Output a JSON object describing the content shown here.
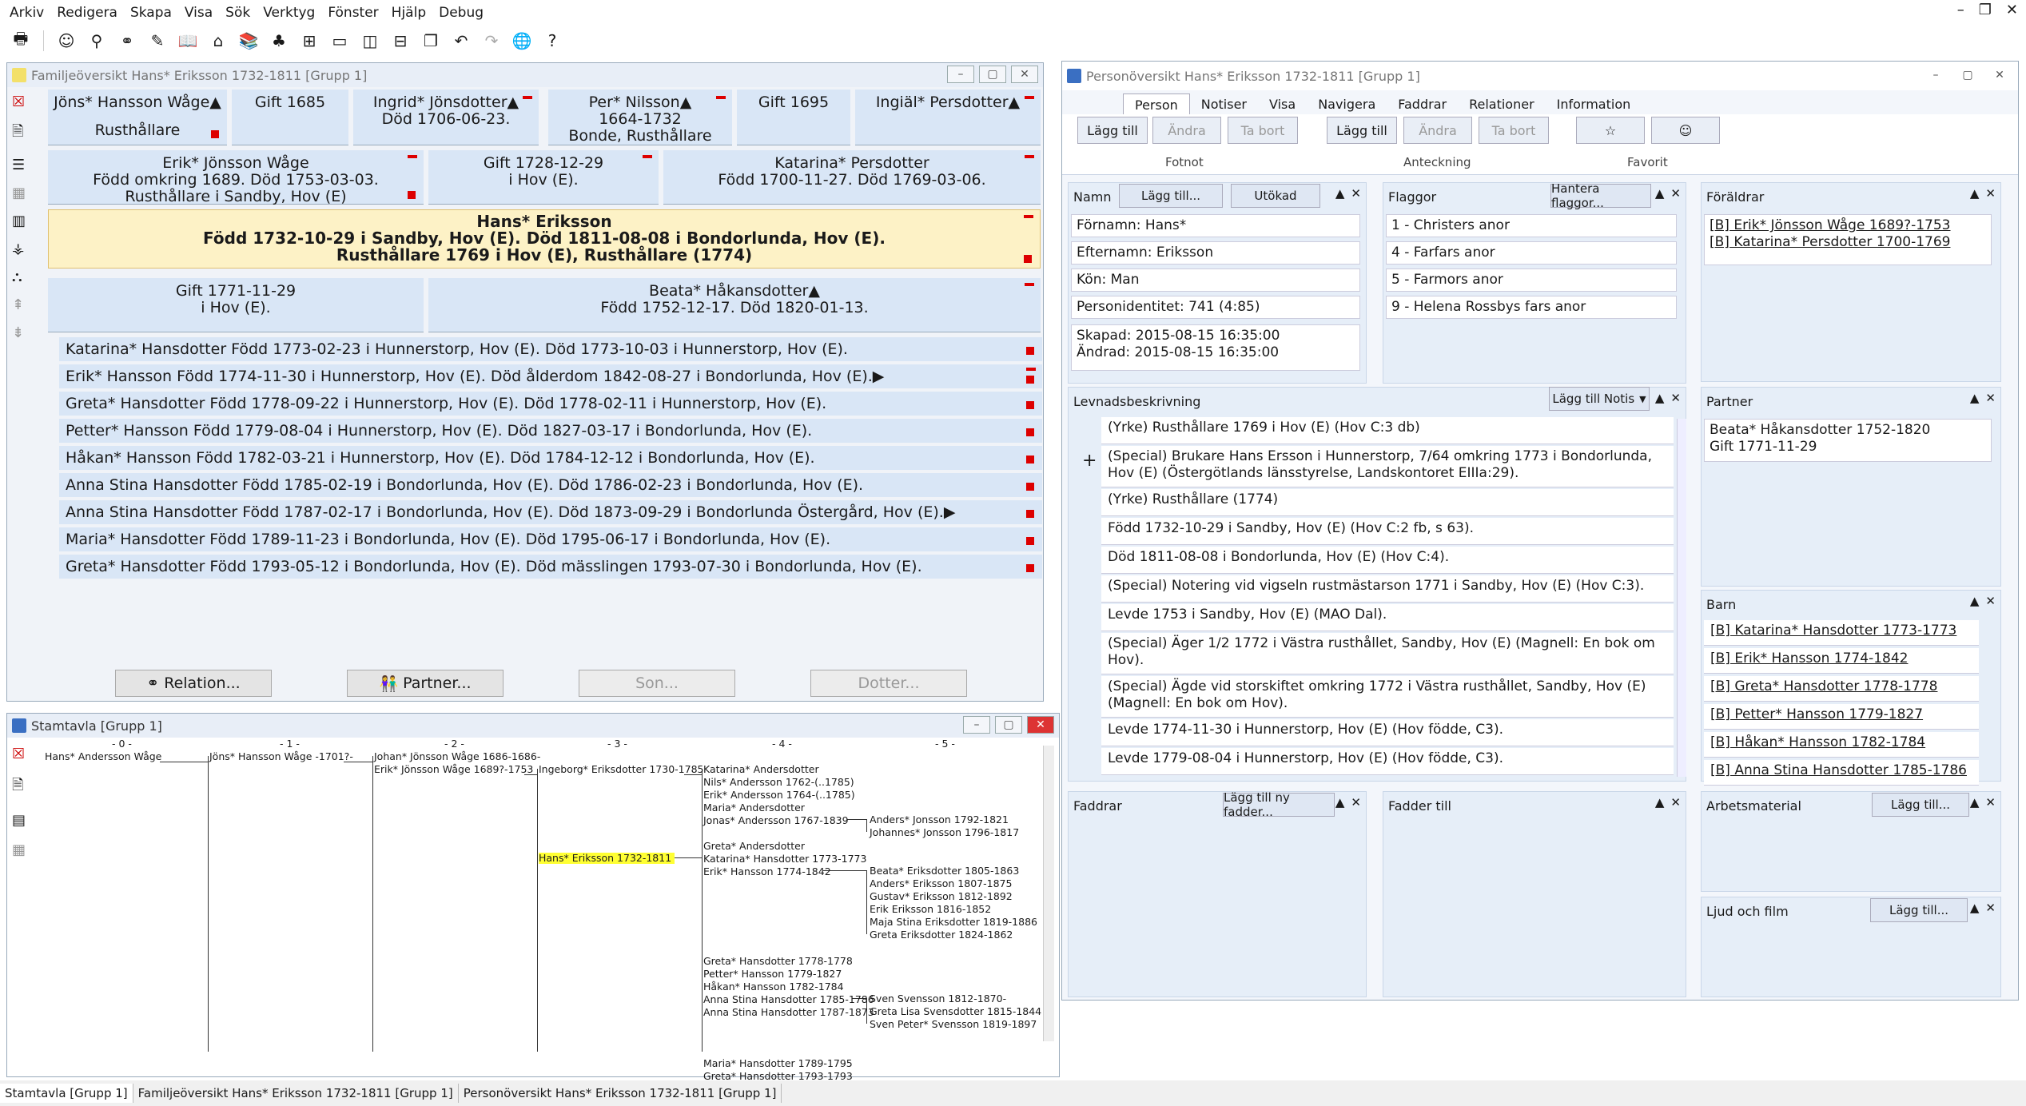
{
  "menu": [
    "Arkiv",
    "Redigera",
    "Skapa",
    "Visa",
    "Sök",
    "Verktyg",
    "Fönster",
    "Hjälp",
    "Debug"
  ],
  "family": {
    "title": "Familjeöversikt Hans* Eriksson 1732-1811 [Grupp 1]",
    "gp1_name": "Jöns* Hansson Wåge▲",
    "gp1_occ": "Rusthållare",
    "gp1_marriage": "Gift 1685",
    "gp2_name": "Ingrid* Jönsdotter▲",
    "gp2_death": "Död 1706-06-23.",
    "gp3_name": "Per* Nilsson▲",
    "gp3_years": "1664-1732",
    "gp3_occ": "Bonde, Rusthållare",
    "gp3_marriage": "Gift 1695",
    "gp4_name": "Ingiäl* Persdotter▲",
    "father_name": "Erik* Jönsson Wåge",
    "father_l2": "Född omkring 1689. Död 1753-03-03.",
    "father_l3": "Rusthållare i Sandby, Hov (E)",
    "parents_marriage": "Gift 1728-12-29",
    "parents_marriage_place": "i  Hov (E).",
    "mother_name": "Katarina* Persdotter",
    "mother_l2": "Född 1700-11-27. Död 1769-03-06.",
    "main_name": "Hans* Eriksson",
    "main_l2": "Född 1732-10-29 i Sandby, Hov (E). Död 1811-08-08 i Bondorlunda, Hov (E).",
    "main_l3": "Rusthållare 1769 i Hov (E), Rusthållare (1774)",
    "marriage": "Gift 1771-11-29",
    "marriage_place": "i  Hov (E).",
    "spouse_name": "Beata* Håkansdotter▲",
    "spouse_l2": "Född 1752-12-17. Död 1820-01-13.",
    "children": [
      "Katarina* Hansdotter Född 1773-02-23 i Hunnerstorp, Hov (E). Död 1773-10-03 i Hunnerstorp, Hov (E).",
      "Erik* Hansson Född 1774-11-30 i Hunnerstorp, Hov (E). Död ålderdom 1842-08-27 i Bondorlunda, Hov (E).▶",
      "Greta* Hansdotter Född 1778-09-22 i Hunnerstorp, Hov (E). Död 1778-02-11 i Hunnerstorp, Hov (E).",
      "Petter* Hansson Född 1779-08-04 i Hunnerstorp, Hov (E). Död 1827-03-17 i Bondorlunda, Hov (E).",
      "Håkan* Hansson Född 1782-03-21 i Hunnerstorp, Hov (E). Död 1784-12-12 i Bondorlunda, Hov (E).",
      "Anna Stina Hansdotter Född 1785-02-19 i Bondorlunda, Hov (E). Död 1786-02-23 i Bondorlunda, Hov (E).",
      "Anna Stina Hansdotter Född 1787-02-17 i Bondorlunda, Hov (E). Död 1873-09-29 i Bondorlunda Östergård, Hov (E).▶",
      "Maria* Hansdotter Född 1789-11-23 i Bondorlunda, Hov (E). Död 1795-06-17 i Bondorlunda, Hov (E).",
      "Greta* Hansdotter Född 1793-05-12 i Bondorlunda, Hov (E). Död mässlingen 1793-07-30 i Bondorlunda, Hov (E)."
    ],
    "btn_relation": "Relation...",
    "btn_partner": "Partner...",
    "btn_son": "Son...",
    "btn_daughter": "Dotter..."
  },
  "pedigree": {
    "title": "Stamtavla [Grupp 1]",
    "cols": [
      "- 0 -",
      "- 1 -",
      "- 2 -",
      "- 3 -",
      "- 4 -",
      "- 5 -"
    ],
    "entries": {
      "c0": "Hans* Andersson Wåge",
      "c1": "Jöns* Hansson Wåge -1701?-",
      "c2a": "Johan* Jönsson Wåge 1686-1686-",
      "c2b": "Erik* Jönsson Wåge 1689?-1753",
      "c3a": "Ingeborg* Eriksdotter 1730-1785",
      "c3b": "Hans* Eriksson 1732-1811",
      "c4": [
        "Katarina* Andersdotter",
        "Nils* Andersson 1762-(..1785)",
        "Erik* Andersson 1764-(..1785)",
        "Maria* Andersdotter",
        "Jonas* Andersson 1767-1839",
        "",
        "Greta* Andersdotter",
        "Katarina* Hansdotter 1773-1773",
        "Erik* Hansson 1774-1842",
        "",
        "",
        "",
        "",
        "",
        "",
        "Greta* Hansdotter 1778-1778",
        "Petter* Hansson 1779-1827",
        "Håkan* Hansson 1782-1784",
        "Anna Stina Hansdotter 1785-1786",
        "Anna Stina Hansdotter 1787-1873",
        "",
        "",
        "",
        "Maria* Hansdotter 1789-1795",
        "Greta* Hansdotter 1793-1793"
      ],
      "c5": [
        "Anders* Jonsson 1792-1821",
        "Johannes* Jonsson 1796-1817",
        "Beata* Eriksdotter 1805-1863",
        "Anders* Eriksson 1807-1875",
        "Gustav* Eriksson 1812-1892",
        "Erik Eriksson 1816-1852",
        "Maja Stina Eriksdotter 1819-1886",
        "Greta Eriksdotter 1824-1862",
        "Sven Svensson 1812-1870-",
        "Greta Lisa Svensdotter 1815-1844",
        "Sven Peter* Svensson 1819-1897"
      ]
    }
  },
  "person": {
    "title": "Personöversikt Hans* Eriksson 1732-1811 [Grupp 1]",
    "tabs": [
      "Person",
      "Notiser",
      "Visa",
      "Navigera",
      "Faddrar",
      "Relationer",
      "Information"
    ],
    "ribbon": {
      "add1": "Lägg till",
      "edit1": "Ändra",
      "del1": "Ta bort",
      "group1": "Fotnot",
      "add2": "Lägg till",
      "edit2": "Ändra",
      "del2": "Ta bort",
      "group2": "Anteckning",
      "group3": "Favorit"
    },
    "namn": {
      "head": "Namn",
      "add": "Lägg till...",
      "expand": "Utökad",
      "first": "Förnamn: Hans*",
      "last": "Efternamn: Eriksson",
      "sex": "Kön: Man",
      "pid": "Personidentitet: 741 (4:85)",
      "created": "Skapad: 2015-08-15 16:35:00",
      "changed": "Ändrad: 2015-08-15 16:35:00"
    },
    "flaggor": {
      "head": "Flaggor",
      "manage": "Hantera flaggor...",
      "items": [
        "1 - Christers anor",
        "4 - Farfars anor",
        "5 - Farmors anor",
        "9 - Helena Rossbys fars anor"
      ]
    },
    "foraldrar": {
      "head": "Föräldrar",
      "items": [
        "[B] Erik* Jönsson Wåge 1689?-1753",
        "[B] Katarina* Persdotter 1700-1769"
      ]
    },
    "levnad": {
      "head": "Levnadsbeskrivning",
      "add": "Lägg till Notis",
      "plus": "+",
      "items": [
        "(Yrke) Rusthållare 1769 i Hov (E) (Hov C:3 db)",
        "(Special) Brukare Hans Ersson i Hunnerstorp, 7/64 omkring 1773 i Bondorlunda, Hov (E) (Östergötlands länsstyrelse, Landskontoret EIIIa:29).",
        "(Yrke) Rusthållare (1774)",
        "Född 1732-10-29 i Sandby, Hov (E) (Hov C:2 fb, s 63).",
        "Död 1811-08-08 i Bondorlunda, Hov (E) (Hov C:4).",
        "(Special) Notering vid vigseln rustmästarson 1771 i Sandby, Hov (E) (Hov C:3).",
        "Levde 1753 i Sandby, Hov (E) (MAO Dal).",
        "(Special) Äger 1/2 1772 i Västra rusthållet, Sandby, Hov (E) (Magnell: En bok om Hov).",
        "(Special) Ägde vid storskiftet omkring 1772 i Västra rusthållet, Sandby, Hov (E) (Magnell: En bok om Hov).",
        "Levde 1774-11-30 i Hunnerstorp, Hov (E) (Hov födde, C3).",
        "Levde 1779-08-04 i Hunnerstorp, Hov (E) (Hov födde, C3)."
      ]
    },
    "partner": {
      "head": "Partner",
      "l1": "Beata* Håkansdotter 1752-1820",
      "l2": "Gift 1771-11-29"
    },
    "barn": {
      "head": "Barn",
      "items": [
        "[B] Katarina* Hansdotter 1773-1773",
        "[B] Erik* Hansson 1774-1842",
        "[B] Greta* Hansdotter 1778-1778",
        "[B] Petter* Hansson 1779-1827",
        "[B] Håkan* Hansson 1782-1784",
        "[B] Anna Stina Hansdotter 1785-1786"
      ]
    },
    "faddrar": {
      "head": "Faddrar",
      "add": "Lägg till ny fadder..."
    },
    "fadder_till": {
      "head": "Fadder till"
    },
    "arbets": {
      "head": "Arbetsmaterial",
      "add": "Lägg till..."
    },
    "ljud": {
      "head": "Ljud och film",
      "add": "Lägg till..."
    }
  },
  "statusbar": [
    "Stamtavla [Grupp 1]",
    "Familjeöversikt Hans* Eriksson 1732-1811 [Grupp 1]",
    "Personöversikt Hans* Eriksson 1732-1811 [Grupp 1]"
  ],
  "colors": {
    "accent": "#d9e6f6",
    "highlight": "#fdf2c6",
    "marker": "#dd0000",
    "pedigree_highlight": "#ffff33"
  }
}
